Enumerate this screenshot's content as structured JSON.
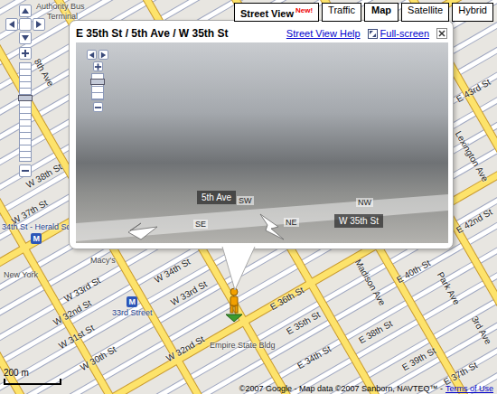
{
  "map_types": [
    {
      "label": "Street View",
      "badge": "New!",
      "selected": true
    },
    {
      "label": "Traffic",
      "badge": "",
      "selected": false
    },
    {
      "label": "Map",
      "badge": "",
      "selected": true
    },
    {
      "label": "Satellite",
      "badge": "",
      "selected": false
    },
    {
      "label": "Hybrid",
      "badge": "",
      "selected": false
    }
  ],
  "zoom": {
    "level": 0.65
  },
  "bubble": {
    "title": "E 35th St / 5th Ave / W 35th St",
    "help": "Street View Help",
    "fullscreen": "Full-screen"
  },
  "street_view": {
    "zoom_level": 0.75,
    "road_labels": [
      "5th Ave",
      "W 35th St"
    ],
    "directions": [
      "SE",
      "NE",
      "SW",
      "NW"
    ]
  },
  "map_labels": [
    {
      "text": "Authority Bus",
      "kind": "place"
    },
    {
      "text": "Terminal",
      "kind": "place"
    },
    {
      "text": "8th Ave",
      "kind": "avenue"
    },
    {
      "text": "W 38th St",
      "kind": "street"
    },
    {
      "text": "W 37th St",
      "kind": "street"
    },
    {
      "text": "Macy's",
      "kind": "place"
    },
    {
      "text": "New York",
      "kind": "place"
    },
    {
      "text": "W 33rd St",
      "kind": "street"
    },
    {
      "text": "W 32nd St",
      "kind": "street"
    },
    {
      "text": "W 31st St",
      "kind": "street"
    },
    {
      "text": "W 30th St",
      "kind": "street"
    },
    {
      "text": "W 34th St",
      "kind": "street"
    },
    {
      "text": "W 33rd St",
      "kind": "street"
    },
    {
      "text": "W 32nd St",
      "kind": "street"
    },
    {
      "text": "Empire State Bldg",
      "kind": "place"
    },
    {
      "text": "E 36th St",
      "kind": "street"
    },
    {
      "text": "E 35th St",
      "kind": "street"
    },
    {
      "text": "E 34th St",
      "kind": "street"
    },
    {
      "text": "Madison Ave",
      "kind": "avenue"
    },
    {
      "text": "E 38th St",
      "kind": "street"
    },
    {
      "text": "E 40th St",
      "kind": "street"
    },
    {
      "text": "Park Ave",
      "kind": "avenue"
    },
    {
      "text": "E 39th St",
      "kind": "street"
    },
    {
      "text": "E 37th St",
      "kind": "street"
    },
    {
      "text": "3rd Ave",
      "kind": "avenue"
    },
    {
      "text": "Lexington Ave",
      "kind": "avenue"
    },
    {
      "text": "E 43rd St",
      "kind": "street"
    },
    {
      "text": "E 42nd St",
      "kind": "street"
    }
  ],
  "stations": [
    {
      "name": "34th St - Herald Sq",
      "badge": "M"
    },
    {
      "name": "33rd Street",
      "badge": "M"
    }
  ],
  "scale": "200 m",
  "copyright": "©2007 Google - Map data ©2007 Sanborn, NAVTEQ™ -",
  "terms": "Terms of Use"
}
